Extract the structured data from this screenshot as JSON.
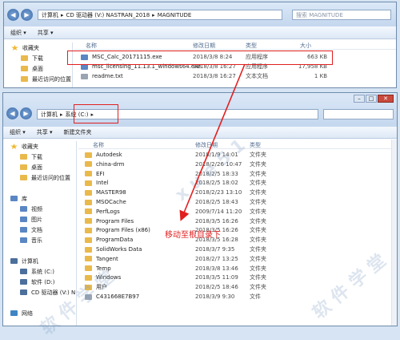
{
  "top_window": {
    "breadcrumb": [
      "计算机",
      "CD 驱动器 (V:) NASTRAN_2018",
      "MAGNITUDE"
    ],
    "search_placeholder": "搜索 MAGNITUDE",
    "toolbar": {
      "organize": "组织 ▾",
      "share": "共享 ▾"
    },
    "sidebar": [
      {
        "label": "收藏夹",
        "icon": "star-icon",
        "sub": false
      },
      {
        "label": "下载",
        "icon": "folder-icon",
        "sub": true
      },
      {
        "label": "桌面",
        "icon": "folder-icon",
        "sub": true
      },
      {
        "label": "最近访问的位置",
        "icon": "folder-icon",
        "sub": true
      }
    ],
    "columns": {
      "name": "名称",
      "date": "修改日期",
      "type": "类型",
      "size": "大小"
    },
    "files": [
      {
        "name": "MSC_Calc_20171115.exe",
        "date": "2018/3/8 8:24",
        "type": "应用程序",
        "size": "663 KB"
      },
      {
        "name": "msc_licensing_11.13.1_windows64.exe",
        "date": "2018/3/8 16:27",
        "type": "应用程序",
        "size": "17,958 KB"
      },
      {
        "name": "readme.txt",
        "date": "2018/3/8 16:27",
        "type": "文本文档",
        "size": "1 KB"
      }
    ]
  },
  "bottom_window": {
    "breadcrumb": [
      "计算机",
      "系统 (C:)"
    ],
    "toolbar": {
      "organize": "组织 ▾",
      "share": "共享 ▾",
      "new_folder": "新建文件夹"
    },
    "sidebar": [
      {
        "label": "收藏夹",
        "icon": "star-icon",
        "sub": false
      },
      {
        "label": "下载",
        "icon": "folder-icon",
        "sub": true
      },
      {
        "label": "桌面",
        "icon": "folder-icon",
        "sub": true
      },
      {
        "label": "最近访问的位置",
        "icon": "folder-icon",
        "sub": true
      },
      {
        "label": "",
        "icon": "",
        "sub": false
      },
      {
        "label": "库",
        "icon": "library-icon",
        "sub": false
      },
      {
        "label": "视频",
        "icon": "video-icon",
        "sub": true
      },
      {
        "label": "图片",
        "icon": "picture-icon",
        "sub": true
      },
      {
        "label": "文档",
        "icon": "document-icon",
        "sub": true
      },
      {
        "label": "音乐",
        "icon": "music-icon",
        "sub": true
      },
      {
        "label": "",
        "icon": "",
        "sub": false
      },
      {
        "label": "计算机",
        "icon": "computer-icon",
        "sub": false
      },
      {
        "label": "系统 (C:)",
        "icon": "drive-icon",
        "sub": true
      },
      {
        "label": "软件 (D:)",
        "icon": "drive-icon",
        "sub": true
      },
      {
        "label": "CD 驱动器 (V:) N",
        "icon": "cd-icon",
        "sub": true
      },
      {
        "label": "",
        "icon": "",
        "sub": false
      },
      {
        "label": "网络",
        "icon": "network-icon",
        "sub": false
      }
    ],
    "columns": {
      "name": "名称",
      "date": "修改日期",
      "type": "类型"
    },
    "folders": [
      {
        "name": "Autodesk",
        "date": "2018/1/9 14:01",
        "type": "文件夹"
      },
      {
        "name": "china-drm",
        "date": "2018/2/26 10:47",
        "type": "文件夹"
      },
      {
        "name": "EFI",
        "date": "2018/2/5 18:33",
        "type": "文件夹"
      },
      {
        "name": "Intel",
        "date": "2018/2/5 18:02",
        "type": "文件夹"
      },
      {
        "name": "MASTER98",
        "date": "2018/2/23 13:10",
        "type": "文件夹"
      },
      {
        "name": "MSOCache",
        "date": "2018/2/5 18:43",
        "type": "文件夹"
      },
      {
        "name": "PerfLogs",
        "date": "2009/7/14 11:20",
        "type": "文件夹"
      },
      {
        "name": "Program Files",
        "date": "2018/3/5 16:26",
        "type": "文件夹"
      },
      {
        "name": "Program Files (x86)",
        "date": "2018/3/5 16:26",
        "type": "文件夹"
      },
      {
        "name": "ProgramData",
        "date": "2018/3/5 16:28",
        "type": "文件夹"
      },
      {
        "name": "SolidWorks Data",
        "date": "2018/3/7 9:35",
        "type": "文件夹"
      },
      {
        "name": "Tangent",
        "date": "2018/2/7 13:25",
        "type": "文件夹"
      },
      {
        "name": "Temp",
        "date": "2018/3/8 13:46",
        "type": "文件夹"
      },
      {
        "name": "Windows",
        "date": "2018/3/5 11:09",
        "type": "文件夹"
      },
      {
        "name": "用户",
        "date": "2018/2/5 18:46",
        "type": "文件夹"
      },
      {
        "name": "C431668E7B97",
        "date": "2018/3/9 9:30",
        "type": "文件"
      }
    ]
  },
  "annotation": "移动至根目录下",
  "colors": {
    "highlight": "#e12020",
    "frame": "#6f8bab"
  }
}
